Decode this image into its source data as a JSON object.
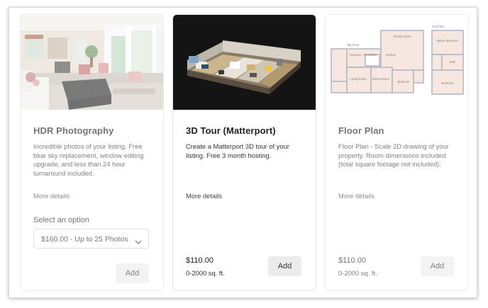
{
  "cards": [
    {
      "title": "HDR Photography",
      "description": "Incredible photos of your listing. Free blue sky replacement, window editing upgrade, and less than 24 hour turnaround included.",
      "more_details": "More details",
      "select_label": "Select an option",
      "select_value": "$160.00 - Up to 25 Photos",
      "add_label": "Add",
      "image_icon": "living-room-photo",
      "state": "dimmed"
    },
    {
      "title": "3D Tour (Matterport)",
      "description": "Create a Matterport 3D tour of your listing. Free 3 month hosting.",
      "more_details": "More details",
      "price": "$110.00",
      "range": "0-2000 sq. ft.",
      "add_label": "Add",
      "image_icon": "3d-dollhouse-tour",
      "state": "active"
    },
    {
      "title": "Floor Plan",
      "description": "Floor Plan - Scale 2D drawing of your property. Room dimensions included (total square footage not included).",
      "more_details": "More details",
      "price": "$110.00",
      "range": "0-2000 sq. ft.",
      "add_label": "Add",
      "image_icon": "floor-plan-drawing",
      "state": "dimmed",
      "floorplan_labels": {
        "top_floor": "Top Floor",
        "second_floor": "2nd Floor",
        "family_room": "Family Room",
        "sunroom": "Sunroom",
        "breakfast": "Breakfast",
        "kitchen": "Kitchen",
        "living_room": "Living Room",
        "dining_room": "Dining Room",
        "bedroom": "Bedroom",
        "master_bedroom": "Master Bedroom",
        "bath": "Bath"
      }
    }
  ],
  "colors": {
    "button_bg": "#ececec",
    "card_border": "#e3e3e3",
    "text": "#222222",
    "floorplan_fill": "#f2d9cf",
    "floorplan_wall": "#8a8fa0"
  }
}
